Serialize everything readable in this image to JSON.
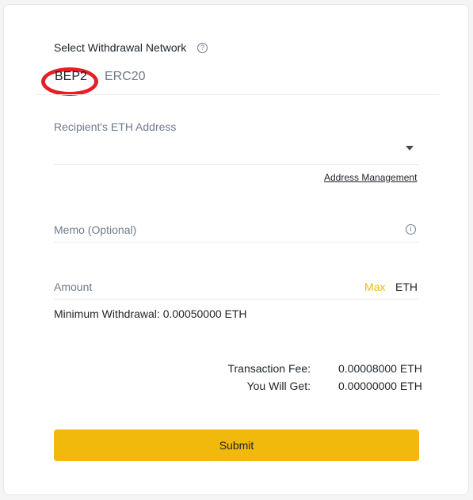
{
  "network": {
    "title": "Select Withdrawal Network",
    "help_icon": "question-circle-icon",
    "tabs": [
      {
        "label": "BEP2",
        "selected": true
      },
      {
        "label": "ERC20",
        "selected": false
      }
    ]
  },
  "recipient": {
    "label": "Recipient's ETH Address",
    "value": "",
    "dropdown_icon": "caret-down-icon",
    "address_management_link": "Address Management"
  },
  "memo": {
    "label": "Memo (Optional)",
    "value": "",
    "info_icon": "info-circle-icon"
  },
  "amount": {
    "label": "Amount",
    "value": "",
    "max_label": "Max",
    "unit": "ETH",
    "minimum_withdrawal": "Minimum Withdrawal: 0.00050000 ETH"
  },
  "summary": {
    "transaction_fee_label": "Transaction Fee:",
    "transaction_fee_value": "0.00008000 ETH",
    "you_will_get_label": "You Will Get:",
    "you_will_get_value": "0.00000000 ETH"
  },
  "submit_label": "Submit",
  "colors": {
    "accent": "#f0b90b",
    "highlight_circle": "#e61f26",
    "text_primary": "#1e2329",
    "text_secondary": "#707a8a"
  }
}
